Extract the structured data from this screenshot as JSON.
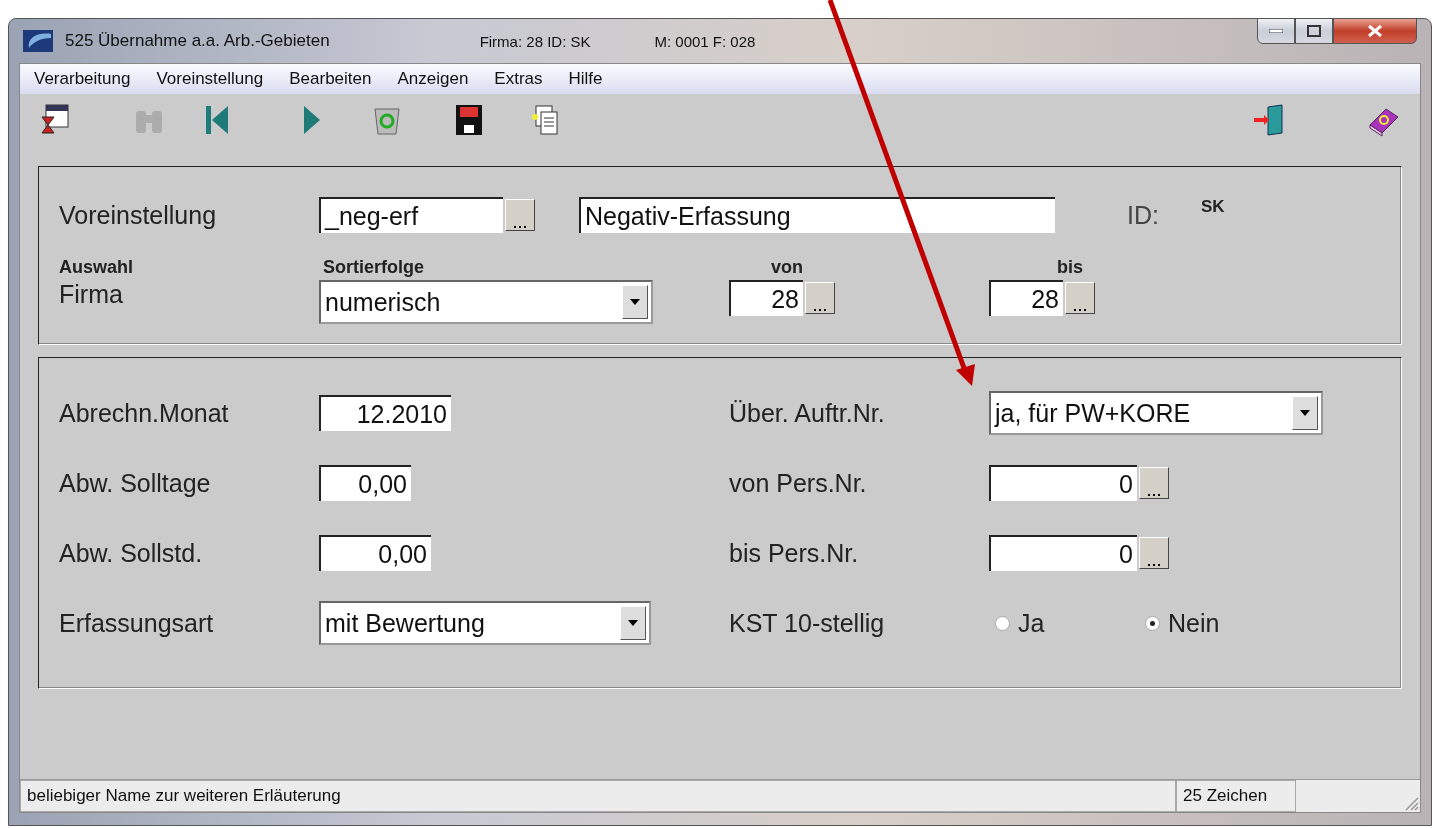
{
  "window": {
    "title": "525 Übernahme a.a. Arb.-Gebieten",
    "info": [
      "Firma:  28  ID: SK",
      "M: 0001 F: 028"
    ]
  },
  "menu": [
    {
      "label": "Verarbeitung"
    },
    {
      "label": "Voreinstellung"
    },
    {
      "label": "Bearbeiten"
    },
    {
      "label": "Anzeigen"
    },
    {
      "label": "Extras"
    },
    {
      "label": "Hilfe"
    }
  ],
  "toolbar": [
    {
      "kind": "process",
      "disabled": false
    },
    {
      "kind": "binoculars",
      "disabled": true
    },
    {
      "kind": "first",
      "disabled": false
    },
    {
      "kind": "next",
      "disabled": false
    },
    {
      "kind": "recycle",
      "disabled": false
    },
    {
      "kind": "save",
      "disabled": false
    },
    {
      "kind": "documents",
      "disabled": false
    }
  ],
  "toolbar_right": [
    {
      "kind": "exit",
      "disabled": false
    },
    {
      "kind": "help",
      "disabled": false
    }
  ],
  "preset": {
    "label": "Voreinstellung",
    "code": "_neg-erf",
    "name": "Negativ-Erfassung",
    "id_label": "ID:",
    "id_value": "SK"
  },
  "selection": {
    "headings": [
      "Auswahl",
      "Sortierfolge",
      "von",
      "bis"
    ],
    "label": "Firma",
    "sort": "numerisch",
    "from": "28",
    "to": "28"
  },
  "fields": [
    {
      "label": "Abrechn.Monat",
      "kind": "text",
      "value": "12.2010"
    },
    {
      "label": "Über. Auftr.Nr.",
      "kind": "combo",
      "value": "ja, für PW+KORE"
    },
    {
      "label": "Abw. Solltage",
      "kind": "number",
      "value": "0,00"
    },
    {
      "label": "von Pers.Nr.",
      "kind": "lookup",
      "value": "0"
    },
    {
      "label": "Abw. Sollstd.",
      "kind": "number",
      "value": "0,00"
    },
    {
      "label": "bis Pers.Nr.",
      "kind": "lookup",
      "value": "0"
    },
    {
      "label": "Erfassungsart",
      "kind": "combo",
      "value": "mit Bewertung"
    },
    {
      "label": "KST 10-stellig",
      "kind": "radio",
      "options": [
        {
          "label": "Ja",
          "selected": false
        },
        {
          "label": "Nein",
          "selected": true
        }
      ]
    }
  ],
  "status_bar": {
    "message": "beliebiger Name zur weiteren Erläuterung",
    "count": "25 Zeichen"
  },
  "annotations": [
    {
      "kind": "arrow"
    }
  ]
}
